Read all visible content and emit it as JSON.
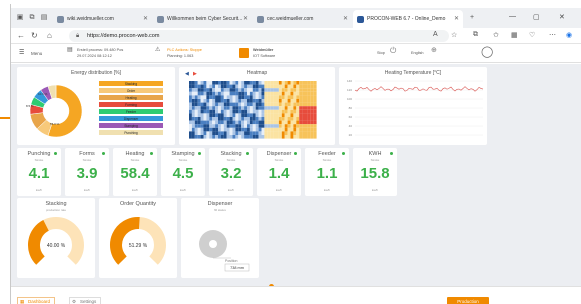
{
  "browser": {
    "tabs": [
      {
        "title": "wiki.weidmueller.com",
        "active": false
      },
      {
        "title": "Willkommen beim Cyber Securit...",
        "active": false
      },
      {
        "title": "cec.weidmueller.com",
        "active": false
      },
      {
        "title": "PROCON-WEB 6.7 - Online_Demo",
        "active": true
      }
    ],
    "url": "https://demo.procon-web.com"
  },
  "header": {
    "menu_label": "Menu",
    "info_line1": "Erstell process: 09.480 Pos",
    "info_line2": "29.07.2024 08:12:12",
    "alert_line1": "PLC Actions: Stoppe",
    "alert_line2": "Planning: 1.063",
    "brand_line1": "Weidmüller",
    "brand_line2": "IOT Software",
    "stop_label": "Stop",
    "lang_label": "English"
  },
  "energy": {
    "title": "Energy distribution [%]",
    "legend": [
      "Stacking",
      "Order",
      "Heating",
      "Forming",
      "Feeder",
      "Dispenser",
      "Stamping",
      "Punching"
    ],
    "colors": [
      "#f5a623",
      "#f7c97a",
      "#e8a54a",
      "#e74c3c",
      "#2ecc71",
      "#3498db",
      "#9b59b6",
      "#f0e0b0"
    ],
    "slices": [
      55,
      8,
      10,
      6,
      5,
      6,
      5,
      5
    ],
    "slice_labels": [
      "55.0 %",
      "8.5 %",
      "10.1 %"
    ]
  },
  "heatmap": {
    "title": "Heatmap"
  },
  "heating_temp": {
    "title": "Heating Temperature [°C]",
    "yticks": [
      "140",
      "120",
      "100",
      "80",
      "60",
      "40",
      "20"
    ]
  },
  "kpis": [
    {
      "title": "Punching",
      "sub": "Stroke",
      "value": "4.1",
      "unit": "kw/h"
    },
    {
      "title": "Forms",
      "sub": "Stroke",
      "value": "3.9",
      "unit": "kw/h"
    },
    {
      "title": "Heating",
      "sub": "Stroke",
      "value": "58.4",
      "unit": "kw/h"
    },
    {
      "title": "Stamping",
      "sub": "Stroke",
      "value": "4.5",
      "unit": "kw/h"
    },
    {
      "title": "Stacking",
      "sub": "Stroke",
      "value": "3.2",
      "unit": "kw/h"
    },
    {
      "title": "Dispenser",
      "sub": "Stroke",
      "value": "1.4",
      "unit": "kw/h"
    },
    {
      "title": "Feeder",
      "sub": "Stroke",
      "value": "1.1",
      "unit": "kw/h"
    },
    {
      "title": "KWH",
      "sub": "Stroke",
      "value": "15.8",
      "unit": "kw/h"
    }
  ],
  "gauges": [
    {
      "title": "Stacking",
      "sub": "production rate",
      "value_label": "40.00 %",
      "fraction": 0.4
    },
    {
      "title": "Order Quantity",
      "sub": "",
      "value_label": "51.29 %",
      "fraction": 0.5129
    }
  ],
  "dispenser": {
    "title": "Dispenser",
    "sub": "fill status",
    "readout_label": "Position",
    "readout_value": "738 mm"
  },
  "footer": {
    "dashboard_label": "Dashboard",
    "settings_label": "Settings",
    "production_label": "Production"
  },
  "colors": {
    "accent": "#f08a00",
    "kpi_green": "#3cb04a",
    "gauge_light": "#fde3b8"
  }
}
